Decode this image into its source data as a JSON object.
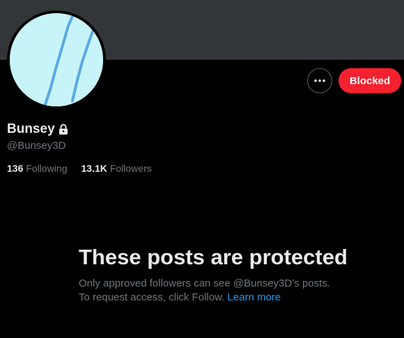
{
  "profile": {
    "display_name": "Bunsey",
    "handle": "@Bunsey3D",
    "protected_icon": "lock-icon",
    "avatar_color": "#c7f4f8"
  },
  "actions": {
    "more_icon": "more-dots-icon",
    "blocked_label": "Blocked",
    "blocked_color": "#f4212e"
  },
  "stats": {
    "following_count": "136",
    "following_label": "Following",
    "followers_count": "13.1K",
    "followers_label": "Followers"
  },
  "protected_notice": {
    "title": "These posts are protected",
    "line1": "Only approved followers can see @Bunsey3D’s posts.",
    "line2": "To request access, click Follow.",
    "link": "Learn more",
    "link_color": "#1d9bf0"
  }
}
